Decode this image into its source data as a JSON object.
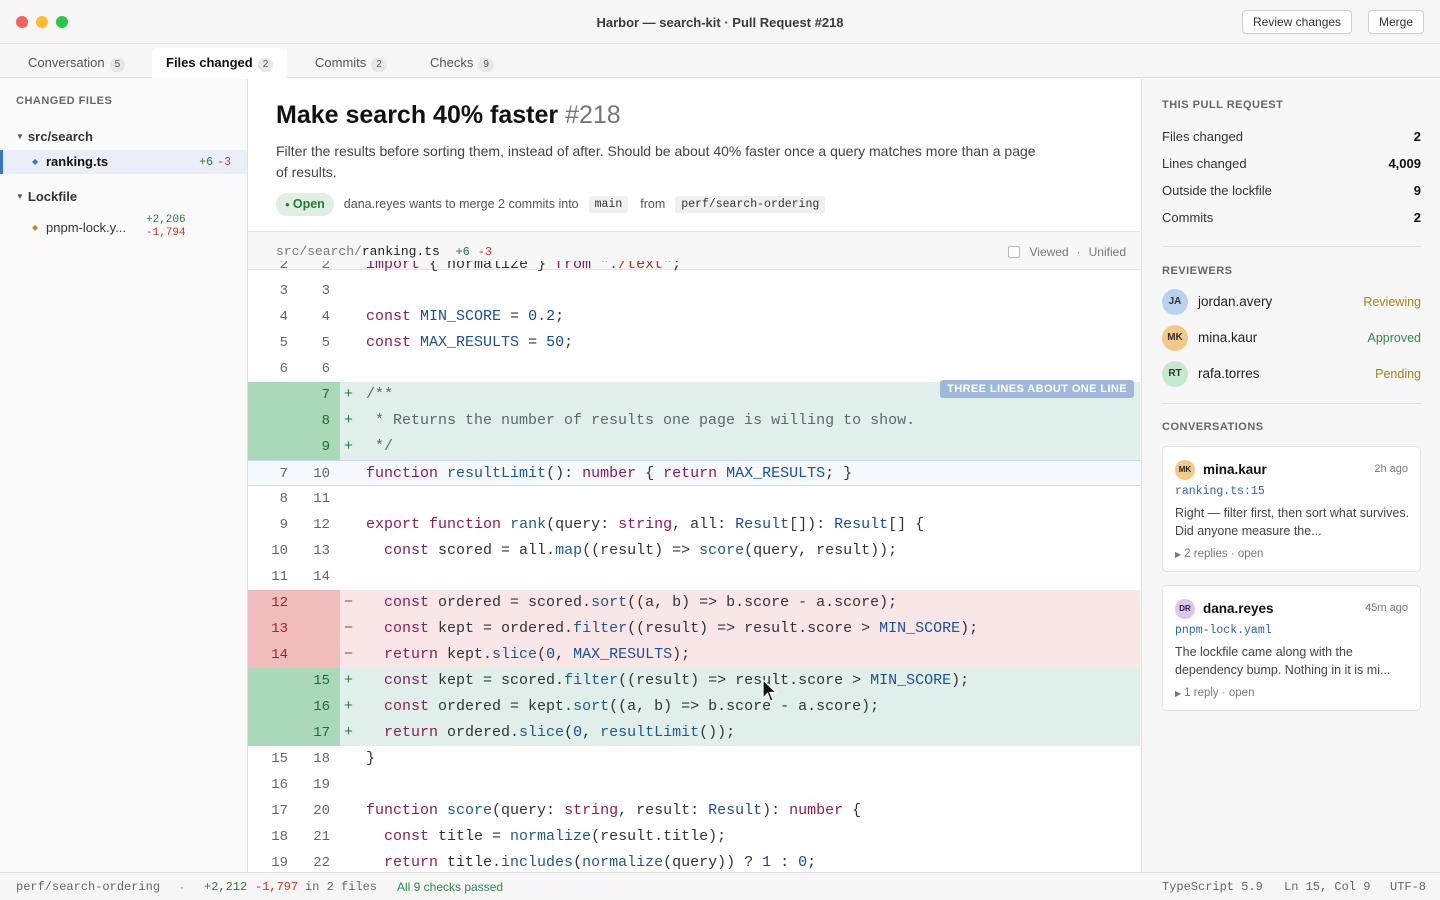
{
  "window": {
    "title": "Harbor — search-kit · Pull Request #218",
    "review_label": "Review changes",
    "merge_label": "Merge"
  },
  "tabs": [
    {
      "label": "Conversation",
      "count": "5"
    },
    {
      "label": "Files changed",
      "count": "2"
    },
    {
      "label": "Commits",
      "count": "2"
    },
    {
      "label": "Checks",
      "count": "9"
    }
  ],
  "sidebar": {
    "heading": "CHANGED FILES",
    "folders": [
      {
        "name": "src/search",
        "files": [
          {
            "name": "ranking.ts",
            "add": "+6",
            "del": "-3"
          }
        ]
      },
      {
        "name": "Lockfile",
        "files": [
          {
            "name": "pnpm-lock.y...",
            "add": "+2,206",
            "del": "-1,794"
          }
        ]
      }
    ]
  },
  "pr": {
    "title": "Make search 40% faster",
    "number": "#218",
    "description": "Filter the results before sorting them, instead of after. Should be about 40% faster once a query matches more than a page of results.",
    "state": "Open",
    "merge_text": "dana.reyes wants to merge 2 commits into",
    "base": "main",
    "from_label": "from",
    "head": "perf/search-ordering"
  },
  "file": {
    "dir": "src/search/",
    "name": "ranking.ts",
    "add": "+6",
    "del": "-3",
    "viewed_label": "Viewed",
    "mode_label": "Unified",
    "annotation": "THREE LINES ABOUT ONE LINE"
  },
  "diff": [
    {
      "old": "2",
      "new": "2",
      "sign": " ",
      "type": "ctx",
      "text": "import { normalize } from \"./text\";"
    },
    {
      "old": "3",
      "new": "3",
      "sign": " ",
      "type": "ctx",
      "text": ""
    },
    {
      "old": "4",
      "new": "4",
      "sign": " ",
      "type": "ctx",
      "text": "const MIN_SCORE = 0.2;"
    },
    {
      "old": "5",
      "new": "5",
      "sign": " ",
      "type": "ctx",
      "text": "const MAX_RESULTS = 50;"
    },
    {
      "old": "6",
      "new": "6",
      "sign": " ",
      "type": "ctx",
      "text": ""
    },
    {
      "old": "",
      "new": "7",
      "sign": "+",
      "type": "add",
      "text": "/**"
    },
    {
      "old": "",
      "new": "8",
      "sign": "+",
      "type": "add",
      "text": " * Returns the number of results one page is willing to show."
    },
    {
      "old": "",
      "new": "9",
      "sign": "+",
      "type": "add",
      "text": " */"
    },
    {
      "old": "7",
      "new": "10",
      "sign": " ",
      "type": "hl",
      "text": "function resultLimit(): number { return MAX_RESULTS; }"
    },
    {
      "old": "8",
      "new": "11",
      "sign": " ",
      "type": "ctx",
      "text": ""
    },
    {
      "old": "9",
      "new": "12",
      "sign": " ",
      "type": "ctx",
      "text": "export function rank(query: string, all: Result[]): Result[] {"
    },
    {
      "old": "10",
      "new": "13",
      "sign": " ",
      "type": "ctx",
      "text": "  const scored = all.map((result) => score(query, result));"
    },
    {
      "old": "11",
      "new": "14",
      "sign": " ",
      "type": "ctx",
      "text": ""
    },
    {
      "old": "12",
      "new": "",
      "sign": "−",
      "type": "del",
      "text": "  const ordered = scored.sort((a, b) => b.score - a.score);"
    },
    {
      "old": "13",
      "new": "",
      "sign": "−",
      "type": "del",
      "text": "  const kept = ordered.filter((result) => result.score > MIN_SCORE);"
    },
    {
      "old": "14",
      "new": "",
      "sign": "−",
      "type": "del",
      "text": "  return kept.slice(0, MAX_RESULTS);"
    },
    {
      "old": "",
      "new": "15",
      "sign": "+",
      "type": "add",
      "text": "  const kept = scored.filter((result) => result.score > MIN_SCORE);"
    },
    {
      "old": "",
      "new": "16",
      "sign": "+",
      "type": "add",
      "text": "  const ordered = kept.sort((a, b) => b.score - a.score);"
    },
    {
      "old": "",
      "new": "17",
      "sign": "+",
      "type": "add",
      "text": "  return ordered.slice(0, resultLimit());"
    },
    {
      "old": "15",
      "new": "18",
      "sign": " ",
      "type": "ctx",
      "text": "}"
    },
    {
      "old": "16",
      "new": "19",
      "sign": " ",
      "type": "ctx",
      "text": ""
    },
    {
      "old": "17",
      "new": "20",
      "sign": " ",
      "type": "ctx",
      "text": "function score(query: string, result: Result): number {"
    },
    {
      "old": "18",
      "new": "21",
      "sign": " ",
      "type": "ctx",
      "text": "  const title = normalize(result.title);"
    },
    {
      "old": "19",
      "new": "22",
      "sign": " ",
      "type": "ctx",
      "text": "  return title.includes(normalize(query)) ? 1 : 0;"
    }
  ],
  "right": {
    "pr_heading": "THIS PULL REQUEST",
    "stats": [
      {
        "label": "Files changed",
        "value": "2"
      },
      {
        "label": "Lines changed",
        "value": "4,009"
      },
      {
        "label": "Outside the lockfile",
        "value": "9"
      },
      {
        "label": "Commits",
        "value": "2"
      }
    ],
    "reviewers_heading": "REVIEWERS",
    "reviewers": [
      {
        "initials": "JA",
        "name": "jordan.avery",
        "status": "Reviewing",
        "color": "#a38416",
        "avatar_bg": "#b9d3ef"
      },
      {
        "initials": "MK",
        "name": "mina.kaur",
        "status": "Approved",
        "color": "#2f8a4c",
        "avatar_bg": "#f3c98a"
      },
      {
        "initials": "RT",
        "name": "rafa.torres",
        "status": "Pending",
        "color": "#a38416",
        "avatar_bg": "#c5e8cf"
      }
    ],
    "conversations_heading": "CONVERSATIONS",
    "conversations": [
      {
        "initials": "MK",
        "name": "mina.kaur",
        "time": "2h ago",
        "ref": "ranking.ts:15",
        "body": "Right — filter first, then sort what survives. Did anyone measure the...",
        "footer": "2 replies · open",
        "avatar_bg": "#f3c98a"
      },
      {
        "initials": "DR",
        "name": "dana.reyes",
        "time": "45m ago",
        "ref": "pnpm-lock.yaml",
        "body": "The lockfile came along with the dependency bump. Nothing in it is mi...",
        "footer": "1 reply · open",
        "avatar_bg": "#ddc6ee"
      }
    ]
  },
  "statusbar": {
    "branch": "perf/search-ordering",
    "sep": "·",
    "add": "+2,212",
    "del": "-1,797",
    "files": "in 2 files",
    "checks": "All 9 checks passed",
    "lang": "TypeScript 5.9",
    "pos": "Ln 15, Col 9",
    "enc": "UTF-8"
  }
}
